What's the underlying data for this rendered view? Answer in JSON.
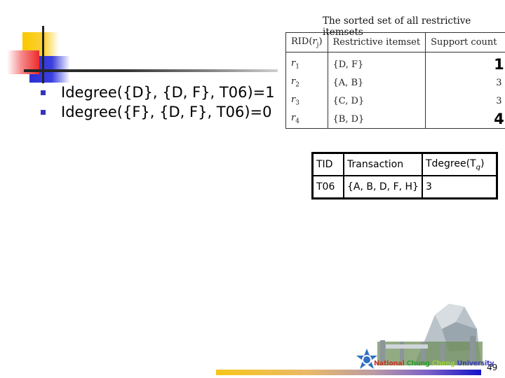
{
  "slide": {
    "bullets": [
      "Idegree({D}, {D, F}, T06)=1",
      "Idegree({F}, {D, F}, T06)=0"
    ],
    "restrictive_table": {
      "caption": "The sorted set of all restrictive itemsets",
      "headers": {
        "rid_prefix": "RID(",
        "rid_var": "r",
        "rid_sub": "j",
        "rid_suffix": ")",
        "itemset": "Restrictive itemset",
        "support": "Support count"
      },
      "rows": [
        {
          "rid": "r",
          "sub": "1",
          "itemset": "{D, F}",
          "support": "1",
          "emphasized": true
        },
        {
          "rid": "r",
          "sub": "2",
          "itemset": "{A, B}",
          "support": "3",
          "emphasized": false
        },
        {
          "rid": "r",
          "sub": "3",
          "itemset": "{C, D}",
          "support": "3",
          "emphasized": false
        },
        {
          "rid": "r",
          "sub": "4",
          "itemset": "{B, D}",
          "support": "4",
          "emphasized": true
        }
      ]
    },
    "transaction_table": {
      "headers": {
        "tid": "TID",
        "transaction": "Transaction",
        "tdegree_prefix": "Tdegree(T",
        "tdegree_sub": "q",
        "tdegree_suffix": ")"
      },
      "rows": [
        {
          "tid": "T06",
          "transaction": "{A, B, D, F, H}",
          "tdegree": "3"
        }
      ]
    },
    "footer": {
      "university_words": [
        "National",
        "Chung",
        "Cheng",
        "University"
      ],
      "page_number": "49"
    },
    "colors": {
      "bullet": "#3535b8",
      "deco_yellow": "#f9c800",
      "deco_blue": "#2b2fd6",
      "deco_red": "#ee2a2a"
    }
  }
}
